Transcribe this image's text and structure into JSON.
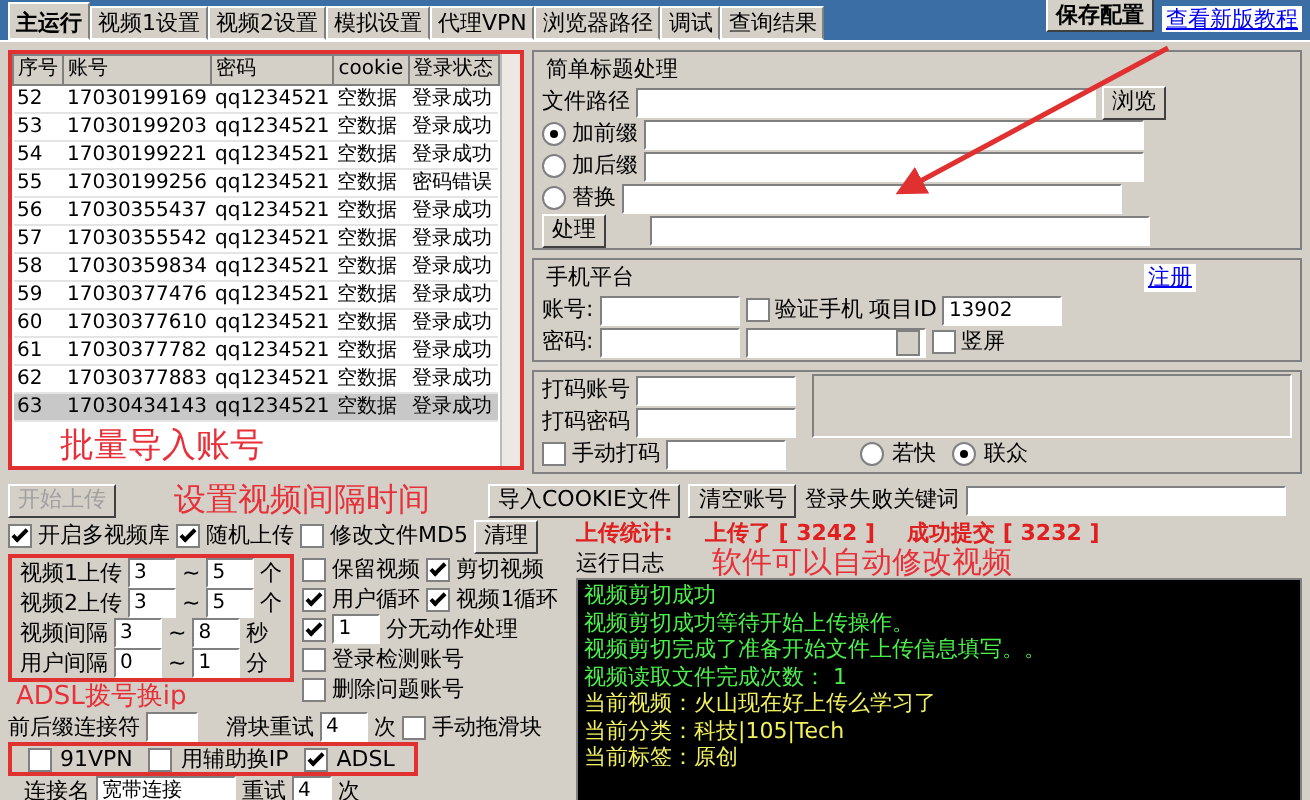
{
  "tabs": [
    {
      "label": "主运行",
      "selected": true
    },
    {
      "label": "视频1设置",
      "selected": false
    },
    {
      "label": "视频2设置",
      "selected": false
    },
    {
      "label": "模拟设置",
      "selected": false
    },
    {
      "label": "代理VPN",
      "selected": false
    },
    {
      "label": "浏览器路径",
      "selected": false
    },
    {
      "label": "调试",
      "selected": false
    },
    {
      "label": "查询结果",
      "selected": false
    }
  ],
  "save_button": "保存配置",
  "tutorial_link": "查看新版教程",
  "accounts_table": {
    "columns": [
      "序号",
      "账号",
      "密码",
      "cookie",
      "登录状态"
    ],
    "rows": [
      {
        "cells": [
          "52",
          "17030199169",
          "qq1234521",
          "空数据",
          "登录成功"
        ],
        "selected": false
      },
      {
        "cells": [
          "53",
          "17030199203",
          "qq1234521",
          "空数据",
          "登录成功"
        ],
        "selected": false
      },
      {
        "cells": [
          "54",
          "17030199221",
          "qq1234521",
          "空数据",
          "登录成功"
        ],
        "selected": false
      },
      {
        "cells": [
          "55",
          "17030199256",
          "qq1234521",
          "空数据",
          "密码错误"
        ],
        "selected": false
      },
      {
        "cells": [
          "56",
          "17030355437",
          "qq1234521",
          "空数据",
          "登录成功"
        ],
        "selected": false
      },
      {
        "cells": [
          "57",
          "17030355542",
          "qq1234521",
          "空数据",
          "登录成功"
        ],
        "selected": false
      },
      {
        "cells": [
          "58",
          "17030359834",
          "qq1234521",
          "空数据",
          "登录成功"
        ],
        "selected": false
      },
      {
        "cells": [
          "59",
          "17030377476",
          "qq1234521",
          "空数据",
          "登录成功"
        ],
        "selected": false
      },
      {
        "cells": [
          "60",
          "17030377610",
          "qq1234521",
          "空数据",
          "登录成功"
        ],
        "selected": false
      },
      {
        "cells": [
          "61",
          "17030377782",
          "qq1234521",
          "空数据",
          "登录成功"
        ],
        "selected": false
      },
      {
        "cells": [
          "62",
          "17030377883",
          "qq1234521",
          "空数据",
          "登录成功"
        ],
        "selected": false
      },
      {
        "cells": [
          "63",
          "17030434143",
          "qq1234521",
          "空数据",
          "登录成功"
        ],
        "selected": true
      }
    ]
  },
  "title_panel": {
    "title": "简单标题处理",
    "file_path_label": "文件路径",
    "browse_button": "浏览",
    "options": [
      {
        "label": "加前缀",
        "selected": true
      },
      {
        "label": "加后缀",
        "selected": false
      },
      {
        "label": "替换",
        "selected": false
      }
    ],
    "process_button": "处理"
  },
  "phone_panel": {
    "title": "手机平台",
    "register_link": "注册",
    "account_label": "账号:",
    "password_label": "密码:",
    "verify_phone": {
      "label": "验证手机",
      "checked": false
    },
    "project_id_label": "项目ID",
    "project_id": "13902",
    "portrait": {
      "label": "竖屏",
      "checked": false
    }
  },
  "captcha": {
    "account_label": "打码账号",
    "password_label": "打码密码",
    "manual": {
      "label": "手动打码",
      "checked": false
    },
    "services": [
      {
        "label": "若快",
        "selected": false
      },
      {
        "label": "联众",
        "selected": true
      }
    ]
  },
  "action_bar": {
    "start_button": {
      "label": "开始上传",
      "disabled": true
    },
    "import_cookie_button": "导入COOKIE文件",
    "clear_button": "清空账号",
    "fail_keyword_label": "登录失败关键词"
  },
  "upload_options": {
    "toggles": [
      {
        "label": "开启多视频库",
        "checked": true
      },
      {
        "label": "随机上传",
        "checked": true
      },
      {
        "label": "修改文件MD5",
        "checked": false
      }
    ],
    "clean_button": "清理",
    "ranges": [
      {
        "label": "视频1上传",
        "from": "3",
        "sep": "~",
        "to": "5",
        "unit": "个"
      },
      {
        "label": "视频2上传",
        "from": "3",
        "sep": "~",
        "to": "5",
        "unit": "个"
      },
      {
        "label": "视频间隔",
        "from": "3",
        "sep": "~",
        "to": "8",
        "unit": "秒"
      },
      {
        "label": "用户间隔",
        "from": "0",
        "sep": "~",
        "to": "1",
        "unit": "分"
      }
    ],
    "flags": [
      {
        "label": "保留视频",
        "checked": false
      },
      {
        "label": "剪切视频",
        "checked": true
      },
      {
        "label": "用户循环",
        "checked": true
      },
      {
        "label": "视频1循环",
        "checked": true
      }
    ],
    "idle": {
      "checked": true,
      "value": "1",
      "label": "分无动作处理"
    },
    "more_flags": [
      {
        "label": "登录检测账号",
        "checked": false
      },
      {
        "label": "删除问题账号",
        "checked": false
      }
    ],
    "joiner_label": "前后缀连接符",
    "slider_retry": {
      "label": "滑块重试",
      "value": "4",
      "unit": "次"
    },
    "manual_slider": {
      "label": "手动拖滑块",
      "checked": false
    }
  },
  "network": [
    {
      "label": "91VPN",
      "checked": false
    },
    {
      "label": "用辅助换IP",
      "checked": false
    },
    {
      "label": "ADSL",
      "checked": true
    }
  ],
  "connection": {
    "label": "连接名",
    "value": "宽带连接",
    "retry_label": "重试",
    "retry": "4",
    "unit": "次"
  },
  "stats": {
    "label": "上传统计:",
    "uploaded": "上传了 [ 3242 ]",
    "success": "成功提交 [ 3232 ]"
  },
  "log": {
    "title": "运行日志",
    "lines": [
      {
        "text": "视频剪切成功",
        "kind": "info"
      },
      {
        "text": "视频剪切成功等待开始上传操作。",
        "kind": "info"
      },
      {
        "text": "视频剪切完成了准备开始文件上传信息填写。。",
        "kind": "info"
      },
      {
        "text": "视频读取文件完成次数： 1",
        "kind": "info"
      },
      {
        "text": "当前视频：火山现在好上传么学习了",
        "kind": "current"
      },
      {
        "text": "当前分类：科技|105|Tech",
        "kind": "current"
      },
      {
        "text": "当前标签：原创",
        "kind": "current"
      }
    ]
  },
  "annotations": [
    "批量导入账号",
    "设置视频间隔时间",
    "ADSL拨号换ip",
    "软件可以自动修改视频"
  ]
}
